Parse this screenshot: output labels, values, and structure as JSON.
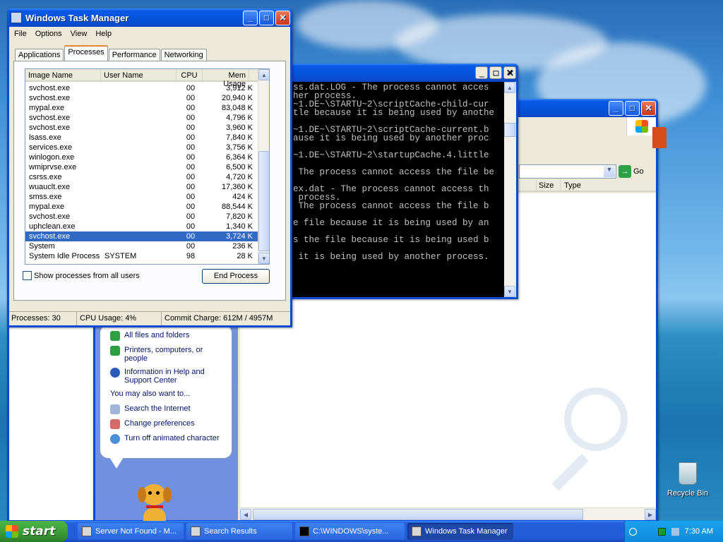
{
  "desktop": {
    "recycle_bin_label": "Recycle Bin"
  },
  "search_window": {
    "address_go": "Go",
    "columns": [
      "Size",
      "Type"
    ],
    "assistant_links": [
      "All files and folders",
      "Printers, computers, or people",
      "Information in Help and Support Center"
    ],
    "also_want": "You may also want to...",
    "assistant_more": [
      "Search the Internet",
      "Change preferences",
      "Turn off animated character"
    ]
  },
  "cmd_window": {
    "lines": [
      "ss.dat.LOG - The process cannot acces",
      "her process.",
      "~1.DE~\\STARTU~2\\scriptCache-child-cur",
      "tle because it is being used by anothe",
      "",
      "~1.DE~\\STARTU~2\\scriptCache-current.b",
      "ause it is being used by another proc",
      "",
      "~1.DE~\\STARTU~2\\startupCache.4.little",
      "",
      " The process cannot access the file be",
      "",
      "ex.dat - The process cannot access th",
      " process.",
      " The process cannot access the file b",
      "",
      "e file because it is being used by an",
      "",
      "s the file because it is being used b",
      "",
      " it is being used by another process."
    ]
  },
  "task_manager": {
    "title": "Windows Task Manager",
    "menu": [
      "File",
      "Options",
      "View",
      "Help"
    ],
    "tabs": [
      "Applications",
      "Processes",
      "Performance",
      "Networking"
    ],
    "columns": [
      "Image Name",
      "User Name",
      "CPU",
      "Mem Usage"
    ],
    "rows": [
      {
        "name": "svchost.exe",
        "user": "",
        "cpu": "00",
        "mem": "3,912 K"
      },
      {
        "name": "svchost.exe",
        "user": "",
        "cpu": "00",
        "mem": "20,940 K"
      },
      {
        "name": "mypal.exe",
        "user": "",
        "cpu": "00",
        "mem": "83,048 K"
      },
      {
        "name": "svchost.exe",
        "user": "",
        "cpu": "00",
        "mem": "4,796 K"
      },
      {
        "name": "svchost.exe",
        "user": "",
        "cpu": "00",
        "mem": "3,960 K"
      },
      {
        "name": "lsass.exe",
        "user": "",
        "cpu": "00",
        "mem": "7,840 K"
      },
      {
        "name": "services.exe",
        "user": "",
        "cpu": "00",
        "mem": "3,756 K"
      },
      {
        "name": "winlogon.exe",
        "user": "",
        "cpu": "00",
        "mem": "6,364 K"
      },
      {
        "name": "wmiprvse.exe",
        "user": "",
        "cpu": "00",
        "mem": "6,500 K"
      },
      {
        "name": "csrss.exe",
        "user": "",
        "cpu": "00",
        "mem": "4,720 K"
      },
      {
        "name": "wuauclt.exe",
        "user": "",
        "cpu": "00",
        "mem": "17,360 K"
      },
      {
        "name": "smss.exe",
        "user": "",
        "cpu": "00",
        "mem": "424 K"
      },
      {
        "name": "mypal.exe",
        "user": "",
        "cpu": "00",
        "mem": "88,544 K"
      },
      {
        "name": "svchost.exe",
        "user": "",
        "cpu": "00",
        "mem": "7,820 K"
      },
      {
        "name": "uphclean.exe",
        "user": "",
        "cpu": "00",
        "mem": "1,340 K"
      },
      {
        "name": "svchost.exe",
        "user": "",
        "cpu": "00",
        "mem": "3,724 K",
        "selected": true
      },
      {
        "name": "System",
        "user": "",
        "cpu": "00",
        "mem": "236 K"
      },
      {
        "name": "System Idle Process",
        "user": "SYSTEM",
        "cpu": "98",
        "mem": "28 K"
      }
    ],
    "show_all_label": "Show processes from all users",
    "end_process_label": "End Process",
    "status": {
      "processes": "Processes: 30",
      "cpu": "CPU Usage: 4%",
      "commit": "Commit Charge: 612M / 4957M"
    }
  },
  "taskbar": {
    "start_label": "start",
    "tasks": [
      "Server Not Found - M...",
      "Search Results",
      "C:\\WINDOWS\\syste...",
      "Windows Task Manager"
    ],
    "clock": "7:30 AM"
  },
  "colors": {
    "selection": "#316ac5",
    "xp_blue": "#0a49d8",
    "face": "#ece9d8"
  }
}
